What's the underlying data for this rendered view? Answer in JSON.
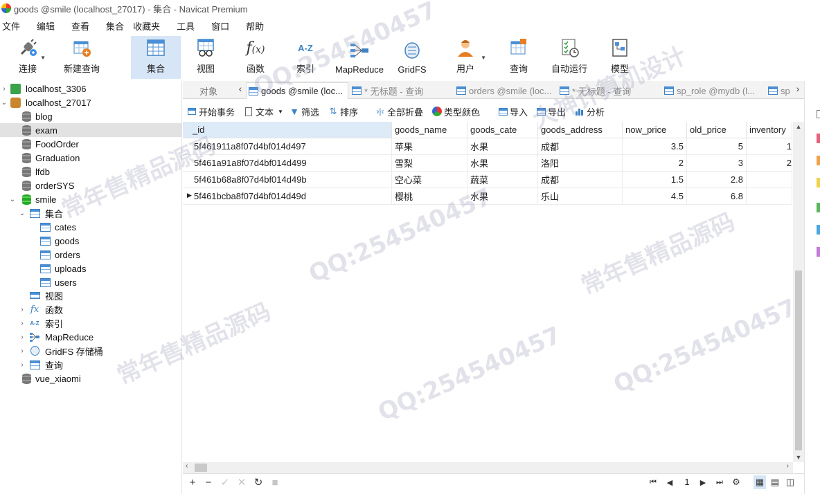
{
  "window": {
    "title": "goods @smile (localhost_27017) - 集合 - Navicat Premium"
  },
  "menu": [
    "文件",
    "编辑",
    "查看",
    "集合",
    "收藏夹",
    "工具",
    "窗口",
    "帮助"
  ],
  "toolbar": {
    "connect": "连接",
    "new_query": "新建查询",
    "collection": "集合",
    "view": "视图",
    "function": "函数",
    "index": "索引",
    "mapreduce": "MapReduce",
    "gridfs": "GridFS",
    "user": "用户",
    "query": "查询",
    "auto_run": "自动运行",
    "model": "模型"
  },
  "sidebar": {
    "items": [
      {
        "label": "localhost_3306"
      },
      {
        "label": "localhost_27017"
      },
      {
        "label": "blog"
      },
      {
        "label": "exam"
      },
      {
        "label": "FoodOrder"
      },
      {
        "label": "Graduation"
      },
      {
        "label": "lfdb"
      },
      {
        "label": "orderSYS"
      },
      {
        "label": "smile"
      },
      {
        "label": "集合"
      },
      {
        "label": "cates"
      },
      {
        "label": "goods"
      },
      {
        "label": "orders"
      },
      {
        "label": "uploads"
      },
      {
        "label": "users"
      },
      {
        "label": "视图"
      },
      {
        "label": "函数"
      },
      {
        "label": "索引"
      },
      {
        "label": "MapReduce"
      },
      {
        "label": "GridFS 存储桶"
      },
      {
        "label": "查询"
      },
      {
        "label": "vue_xiaomi"
      }
    ]
  },
  "tabs": {
    "objects": "对象",
    "items": [
      {
        "label": "goods @smile (loc..."
      },
      {
        "label": "* 无标题 - 查询"
      },
      {
        "label": "orders @smile (loc..."
      },
      {
        "label": "* 无标题 - 查询"
      },
      {
        "label": "sp_role @mydb (l..."
      },
      {
        "label": "sp"
      }
    ]
  },
  "subtoolbar": {
    "begin_tx": "开始事务",
    "text": "文本",
    "filter": "筛选",
    "sort": "排序",
    "collapse_all": "全部折叠",
    "type_color": "类型颜色",
    "import": "导入",
    "export": "导出",
    "analyze": "分析"
  },
  "grid": {
    "columns": [
      "_id",
      "goods_name",
      "goods_cate",
      "goods_address",
      "now_price",
      "old_price",
      "inventory"
    ],
    "rows": [
      [
        "5f461911a8f07d4bf014d497",
        "苹果",
        "水果",
        "成都",
        "3.5",
        "5",
        "1"
      ],
      [
        "5f461a91a8f07d4bf014d499",
        "雪梨",
        "水果",
        "洛阳",
        "2",
        "3",
        "2"
      ],
      [
        "5f461b68a8f07d4bf014d49b",
        "空心菜",
        "蔬菜",
        "成都",
        "1.5",
        "2.8",
        ""
      ],
      [
        "5f461bcba8f07d4bf014d49d",
        "樱桃",
        "水果",
        "乐山",
        "4.5",
        "6.8",
        ""
      ]
    ]
  },
  "pagination": {
    "page": "1"
  },
  "watermarks": [
    "QQ:254540457",
    "常年售精品源码",
    "大神计算机设计"
  ]
}
